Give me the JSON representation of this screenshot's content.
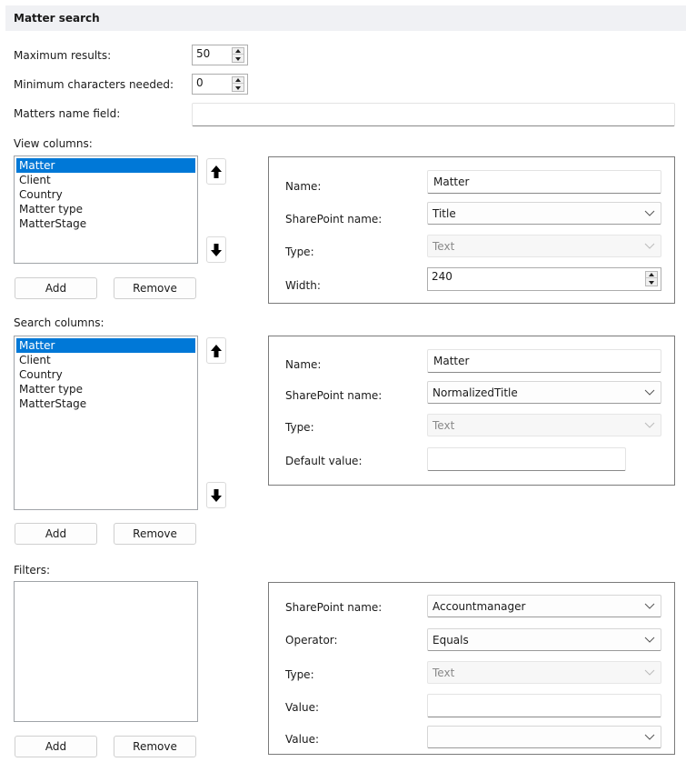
{
  "header": {
    "title": "Matter search"
  },
  "general": {
    "max_results_label": "Maximum results:",
    "max_results_value": "50",
    "min_chars_label": "Minimum characters needed:",
    "min_chars_value": "0",
    "name_field_label": "Matters name field:",
    "name_field_value": ""
  },
  "view_columns": {
    "label": "View columns:",
    "items": [
      "Matter",
      "Client",
      "Country",
      "Matter type",
      "MatterStage"
    ],
    "selected_index": 0,
    "add_label": "Add",
    "remove_label": "Remove",
    "details": {
      "name_label": "Name:",
      "name_value": "Matter",
      "sp_name_label": "SharePoint name:",
      "sp_name_value": "Title",
      "type_label": "Type:",
      "type_value": "Text",
      "width_label": "Width:",
      "width_value": "240"
    }
  },
  "search_columns": {
    "label": "Search columns:",
    "items": [
      "Matter",
      "Client",
      "Country",
      "Matter type",
      "MatterStage"
    ],
    "selected_index": 0,
    "add_label": "Add",
    "remove_label": "Remove",
    "details": {
      "name_label": "Name:",
      "name_value": "Matter",
      "sp_name_label": "SharePoint name:",
      "sp_name_value": "NormalizedTitle",
      "type_label": "Type:",
      "type_value": "Text",
      "default_label": "Default value:",
      "default_value": ""
    }
  },
  "filters": {
    "label": "Filters:",
    "items": [],
    "add_label": "Add",
    "remove_label": "Remove",
    "details": {
      "sp_name_label": "SharePoint name:",
      "sp_name_value": "Accountmanager",
      "operator_label": "Operator:",
      "operator_value": "Equals",
      "type_label": "Type:",
      "type_value": "Text",
      "value_label": "Value:",
      "value_text": "",
      "value2_label": "Value:",
      "value2_select": ""
    }
  },
  "colors": {
    "selection": "#0078d7",
    "header_bg": "#f0f1f4"
  }
}
